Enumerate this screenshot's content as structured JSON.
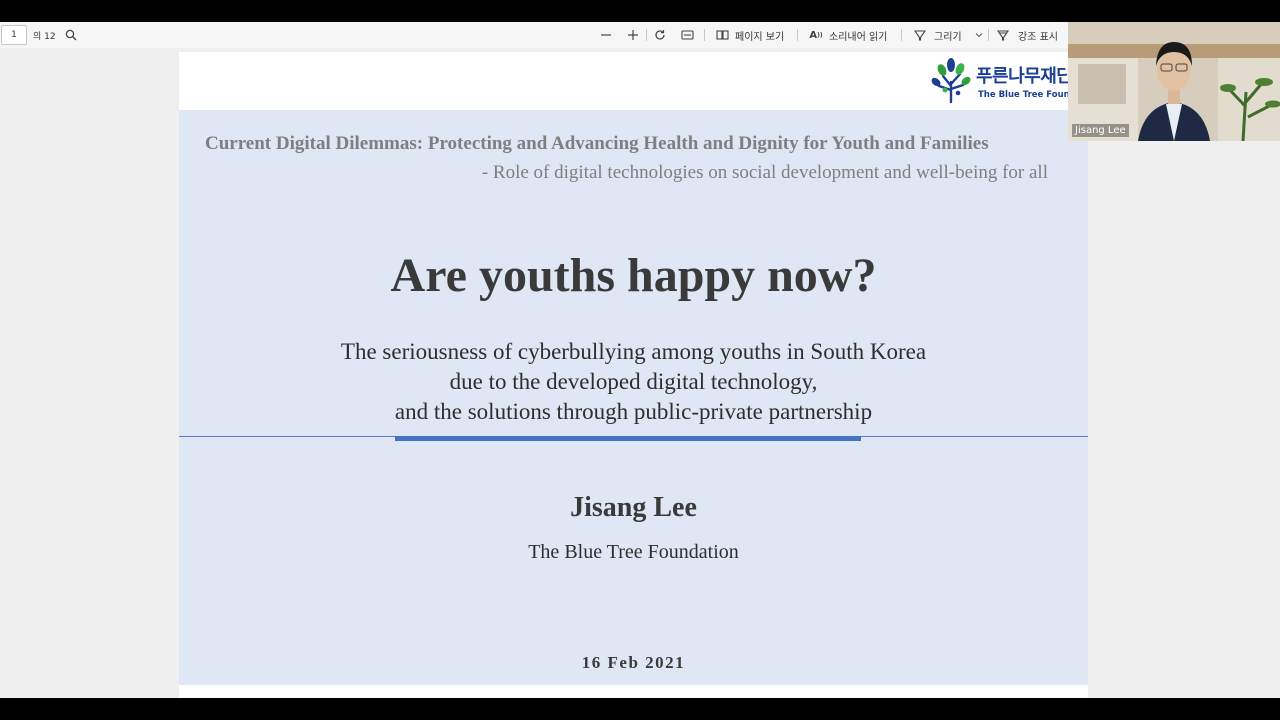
{
  "toolbar": {
    "page_current": "1",
    "page_total": "의 12",
    "page_view_label": "페이지 보기",
    "read_aloud_label": "소리내어 읽기",
    "draw_label": "그리기",
    "highlight_label": "강조 표시",
    "icons": {
      "search": "search-icon",
      "zoom_out": "minus-icon",
      "zoom_in": "plus-icon",
      "rotate": "rotate-icon",
      "fit": "fit-page-icon",
      "page_view": "page-view-icon",
      "read_aloud": "read-aloud-icon",
      "draw": "draw-icon",
      "highlight": "highlight-icon",
      "chevron": "chevron-down-icon"
    }
  },
  "slide": {
    "logo_ko": "푸른나무재단",
    "logo_en": "The Blue Tree Foundation",
    "conference_title": "Current Digital Dilemmas: Protecting and Advancing Health and Dignity for Youth and Families",
    "conference_subtitle": "- Role of digital technologies on social development and well-being for all",
    "main_title": "Are youths happy now?",
    "description_lines": [
      "The seriousness of cyberbullying among youths in South Korea",
      "due to the developed digital technology,",
      "and the solutions through public-private partnership"
    ],
    "speaker": "Jisang Lee",
    "organization": "The Blue Tree Foundation",
    "date": "16  Feb  2021"
  },
  "video": {
    "participant_name": "Jisang Lee"
  },
  "colors": {
    "slide_background": "#dfe6f4",
    "accent_rule": "#4472c4",
    "logo_blue": "#1c3f94",
    "logo_green": "#2e9e3e"
  }
}
